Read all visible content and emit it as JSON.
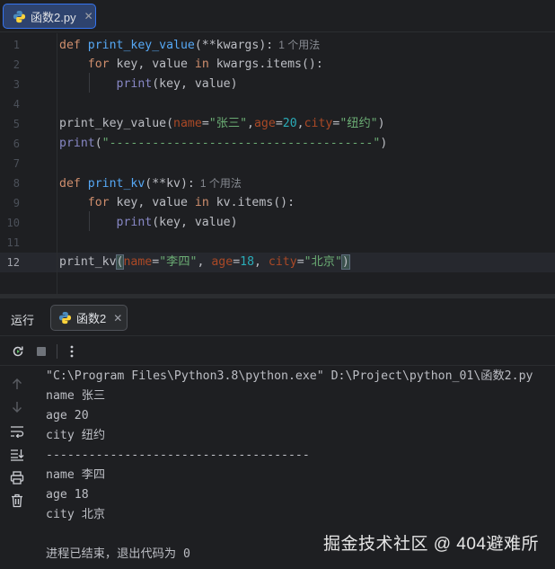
{
  "editor_tab": {
    "label": "函数2.py",
    "close": "✕"
  },
  "editor": {
    "lines": [
      {
        "num": "1",
        "tokens": [
          [
            "kw",
            "def "
          ],
          [
            "fn",
            "print_key_value"
          ],
          [
            "pl",
            "(**kwargs):"
          ]
        ],
        "hint": "1 个用法"
      },
      {
        "num": "2",
        "tokens": [
          [
            "pl",
            "    "
          ],
          [
            "kw",
            "for "
          ],
          [
            "pl",
            "key, value "
          ],
          [
            "kw",
            "in "
          ],
          [
            "pl",
            "kwargs.items():"
          ]
        ]
      },
      {
        "num": "3",
        "tokens": [
          [
            "pl",
            "        "
          ],
          [
            "bi",
            "print"
          ],
          [
            "pl",
            "(key, value)"
          ]
        ]
      },
      {
        "num": "4",
        "tokens": []
      },
      {
        "num": "5",
        "tokens": [
          [
            "pl",
            "print_key_value("
          ],
          [
            "pm",
            "name"
          ],
          [
            "pl",
            "="
          ],
          [
            "str",
            "\"张三\""
          ],
          [
            "pl",
            ","
          ],
          [
            "pm",
            "age"
          ],
          [
            "pl",
            "="
          ],
          [
            "num",
            "20"
          ],
          [
            "pl",
            ","
          ],
          [
            "pm",
            "city"
          ],
          [
            "pl",
            "="
          ],
          [
            "str",
            "\"纽约\""
          ],
          [
            "pl",
            ")"
          ]
        ]
      },
      {
        "num": "6",
        "tokens": [
          [
            "bi",
            "print"
          ],
          [
            "pl",
            "("
          ],
          [
            "str",
            "\"-------------------------------------\""
          ],
          [
            "pl",
            ")"
          ]
        ]
      },
      {
        "num": "7",
        "tokens": []
      },
      {
        "num": "8",
        "tokens": [
          [
            "kw",
            "def "
          ],
          [
            "fn",
            "print_kv"
          ],
          [
            "pl",
            "(**kv):"
          ]
        ],
        "hint": "1 个用法"
      },
      {
        "num": "9",
        "tokens": [
          [
            "pl",
            "    "
          ],
          [
            "kw",
            "for "
          ],
          [
            "pl",
            "key, value "
          ],
          [
            "kw",
            "in "
          ],
          [
            "pl",
            "kv.items():"
          ]
        ]
      },
      {
        "num": "10",
        "tokens": [
          [
            "pl",
            "        "
          ],
          [
            "bi",
            "print"
          ],
          [
            "pl",
            "(key, value)"
          ]
        ]
      },
      {
        "num": "11",
        "tokens": []
      },
      {
        "num": "12",
        "tokens": [
          [
            "pl",
            "print_kv"
          ],
          [
            "brk",
            "("
          ],
          [
            "pm",
            "name"
          ],
          [
            "pl",
            "="
          ],
          [
            "str",
            "\"李四\""
          ],
          [
            "pl",
            ", "
          ],
          [
            "pm",
            "age"
          ],
          [
            "pl",
            "="
          ],
          [
            "num",
            "18"
          ],
          [
            "pl",
            ", "
          ],
          [
            "pm",
            "city"
          ],
          [
            "pl",
            "="
          ],
          [
            "str",
            "\"北京\""
          ],
          [
            "brk",
            ")"
          ]
        ],
        "current": true
      }
    ]
  },
  "run_panel": {
    "title": "运行",
    "tab_label": "函数2",
    "tab_close": "✕",
    "toolbar": [
      "rerun-icon",
      "stop-icon",
      "more-icon"
    ],
    "side_tools": [
      "arrow-up-icon",
      "arrow-down-icon",
      "soft-wrap-icon",
      "scroll-to-end-icon",
      "print-icon",
      "trash-icon"
    ],
    "console_lines": [
      "\"C:\\Program Files\\Python3.8\\python.exe\" D:\\Project\\python_01\\函数2.py",
      "name 张三",
      "age 20",
      "city 纽约",
      "-------------------------------------",
      "name 李四",
      "age 18",
      "city 北京",
      "",
      "进程已结束，退出代码为 0"
    ]
  },
  "watermark": "掘金技术社区 @ 404避难所"
}
